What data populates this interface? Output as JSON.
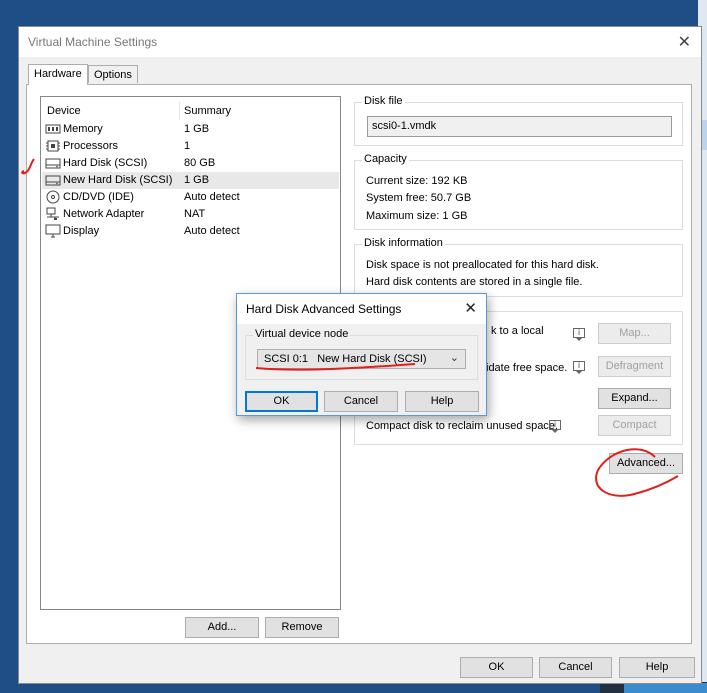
{
  "window": {
    "title": "Virtual Machine Settings",
    "tabs": [
      "Hardware",
      "Options"
    ]
  },
  "devices": {
    "header": {
      "device": "Device",
      "summary": "Summary"
    },
    "rows": [
      {
        "icon": "memory-icon",
        "name": "Memory",
        "summary": "1 GB"
      },
      {
        "icon": "processor-icon",
        "name": "Processors",
        "summary": "1"
      },
      {
        "icon": "hard-disk-icon",
        "name": "Hard Disk (SCSI)",
        "summary": "80 GB"
      },
      {
        "icon": "hard-disk-icon",
        "name": "New Hard Disk (SCSI)",
        "summary": "1 GB",
        "selected": true
      },
      {
        "icon": "cd-dvd-icon",
        "name": "CD/DVD (IDE)",
        "summary": "Auto detect"
      },
      {
        "icon": "network-adapter-icon",
        "name": "Network Adapter",
        "summary": "NAT"
      },
      {
        "icon": "display-icon",
        "name": "Display",
        "summary": "Auto detect"
      }
    ],
    "add_label": "Add...",
    "remove_label": "Remove"
  },
  "disk_file": {
    "label": "Disk file",
    "value": "scsi0-1.vmdk"
  },
  "capacity": {
    "label": "Capacity",
    "current": "Current size: 192 KB",
    "system_free": "System free: 50.7 GB",
    "maximum": "Maximum size: 1 GB"
  },
  "disk_info": {
    "label": "Disk information",
    "line1": "Disk space is not preallocated for this hard disk.",
    "line2": "Hard disk contents are stored in a single file."
  },
  "utilities": {
    "map_text": "k to a local",
    "map_button": "Map...",
    "defrag_text": "idate free space.",
    "defrag_button": "Defragment",
    "expand_button": "Expand...",
    "compact_text": "Compact disk to reclaim unused space.",
    "compact_button": "Compact",
    "advanced_button": "Advanced..."
  },
  "footer": {
    "ok": "OK",
    "cancel": "Cancel",
    "help": "Help"
  },
  "dialog": {
    "title": "Hard Disk Advanced Settings",
    "group_label": "Virtual device node",
    "selected_node": "SCSI 0:1   New Hard Disk (SCSI)",
    "ok": "OK",
    "cancel": "Cancel",
    "help": "Help"
  },
  "colors": {
    "annotation": "#e0201a",
    "focus": "#0078d7"
  }
}
